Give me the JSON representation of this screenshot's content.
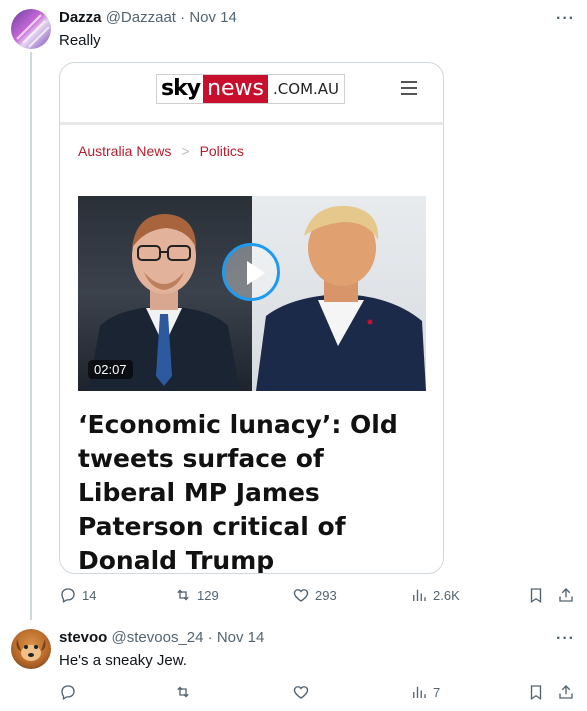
{
  "tweets": [
    {
      "name": "Dazza",
      "handle": "@Dazzaat",
      "dot": "·",
      "date": "Nov 14",
      "text": "Really",
      "more": "···",
      "card": {
        "logo_sky": "sky",
        "logo_news": "news",
        "logo_domain": ".COM.AU",
        "breadcrumb": [
          "Australia News",
          "Politics"
        ],
        "video_duration": "02:07",
        "headline": "‘Economic lunacy’: Old tweets surface of Liberal MP James Paterson critical of Donald Trump"
      },
      "actions": {
        "replies": "14",
        "reposts": "129",
        "likes": "293",
        "views": "2.6K"
      }
    },
    {
      "name": "stevoo",
      "handle": "@stevoos_24",
      "dot": "·",
      "date": "Nov 14",
      "text": "He's a sneaky Jew.",
      "more": "···",
      "actions": {
        "replies": "",
        "reposts": "",
        "likes": "",
        "views": "7"
      }
    }
  ],
  "colors": {
    "accent": "#1d9bf0",
    "sky_red": "#c8102e",
    "muted": "#536471"
  },
  "icons": [
    "reply-icon",
    "repost-icon",
    "like-icon",
    "views-icon",
    "bookmark-icon",
    "share-icon",
    "play-icon",
    "menu-icon"
  ]
}
